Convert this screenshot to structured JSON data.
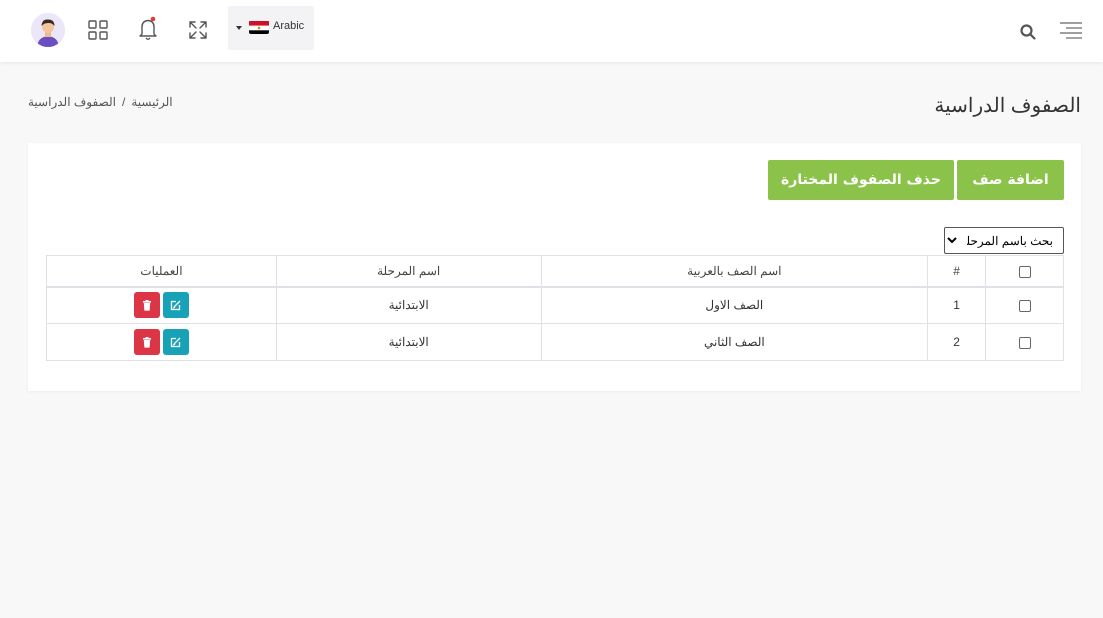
{
  "header": {
    "language": "Arabic"
  },
  "breadcrumb": {
    "home": "الرئيسية",
    "separator": "/",
    "current": "الصفوف الدراسية"
  },
  "page_title": "الصفوف الدراسية",
  "actions": {
    "add_label": "اضافة صف",
    "delete_selected_label": "حذف الصفوف المختارة"
  },
  "filter": {
    "selected": "بحث باسم المرحلة"
  },
  "table": {
    "headers": {
      "number": "#",
      "class_name": "اسم الصف بالعربية",
      "stage_name": "اسم المرحلة",
      "operations": "العمليات"
    },
    "rows": [
      {
        "number": "1",
        "class_name": "الصف الاول",
        "stage_name": "الابتدائية"
      },
      {
        "number": "2",
        "class_name": "الصف الثاني",
        "stage_name": "الابتدائية"
      }
    ]
  },
  "colors": {
    "primary_green": "#8bc34a",
    "delete_red": "#dc3545",
    "edit_teal": "#17a2b8",
    "notification_dot": "#e53935"
  }
}
